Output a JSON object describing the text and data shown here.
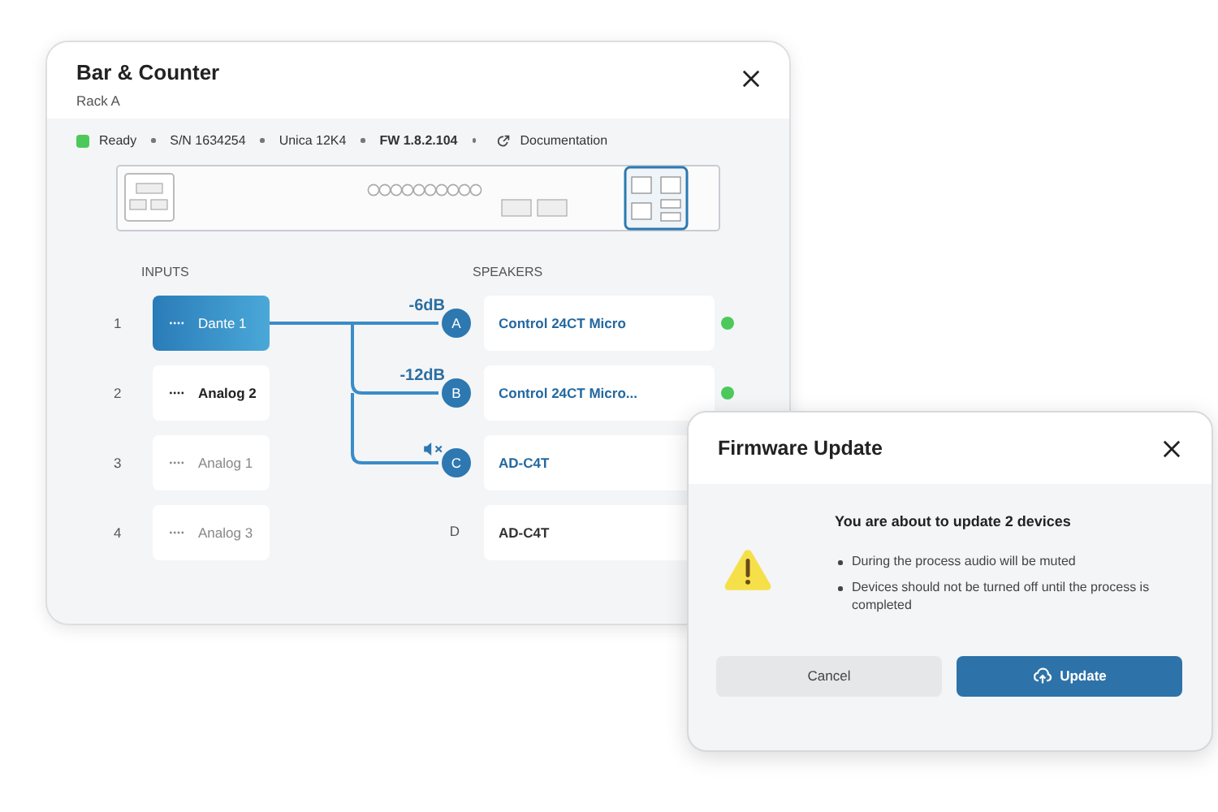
{
  "device": {
    "title": "Bar & Counter",
    "subtitle": "Rack A",
    "status": {
      "label": "Ready",
      "color": "#4cc95a"
    },
    "info": [
      "S/N 1634254",
      "Unica 12K4"
    ],
    "firmware": "FW 1.8.2.104",
    "documentation_link": "Documentation"
  },
  "inputs": {
    "heading": "INPUTS",
    "items": [
      {
        "number": "1",
        "name": "Dante 1",
        "selected": true,
        "active": true
      },
      {
        "number": "2",
        "name": "Analog 2",
        "selected": false,
        "active": true
      },
      {
        "number": "3",
        "name": "Analog 1",
        "selected": false,
        "active": false
      },
      {
        "number": "4",
        "name": "Analog 3",
        "selected": false,
        "active": false
      }
    ]
  },
  "speakers": {
    "heading": "SPEAKERS",
    "items": [
      {
        "port": "A",
        "name": "Control 24CT Micro",
        "connected": true,
        "gain": "-6dB",
        "muted": false,
        "online": true
      },
      {
        "port": "B",
        "name": "Control 24CT Micro...",
        "connected": true,
        "gain": "-12dB",
        "muted": false,
        "online": true
      },
      {
        "port": "C",
        "name": "AD-C4T",
        "connected": true,
        "muted": true
      },
      {
        "port": "D",
        "name": "AD-C4T",
        "connected": false,
        "muted": false
      }
    ]
  },
  "dialog": {
    "title": "Firmware Update",
    "heading": "You are about to update 2 devices",
    "bullets": [
      "During the process audio will be muted",
      "Devices should not be turned off until the process is completed"
    ],
    "buttons": [
      {
        "label": "Cancel",
        "kind": "secondary"
      },
      {
        "label": "Update",
        "kind": "primary"
      }
    ]
  }
}
